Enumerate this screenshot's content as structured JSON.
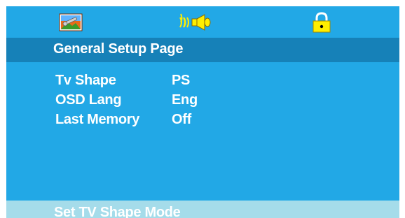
{
  "colors": {
    "screen_bg": "#22a8e6",
    "title_bar_bg": "#1681b8",
    "status_bar_bg": "#a5dcea",
    "text": "#ffffff",
    "lock_fill": "#ffee00"
  },
  "icons": [
    {
      "name": "general-setup-icon",
      "semantic": "tools-picture"
    },
    {
      "name": "audio-setup-icon",
      "semantic": "speaker-sound"
    },
    {
      "name": "preference-lock-icon",
      "semantic": "padlock"
    }
  ],
  "title": "General Setup Page",
  "settings": [
    {
      "label": "Tv Shape",
      "value": "PS"
    },
    {
      "label": "OSD Lang",
      "value": "Eng"
    },
    {
      "label": "Last Memory",
      "value": "Off"
    }
  ],
  "status": "Set TV Shape Mode"
}
